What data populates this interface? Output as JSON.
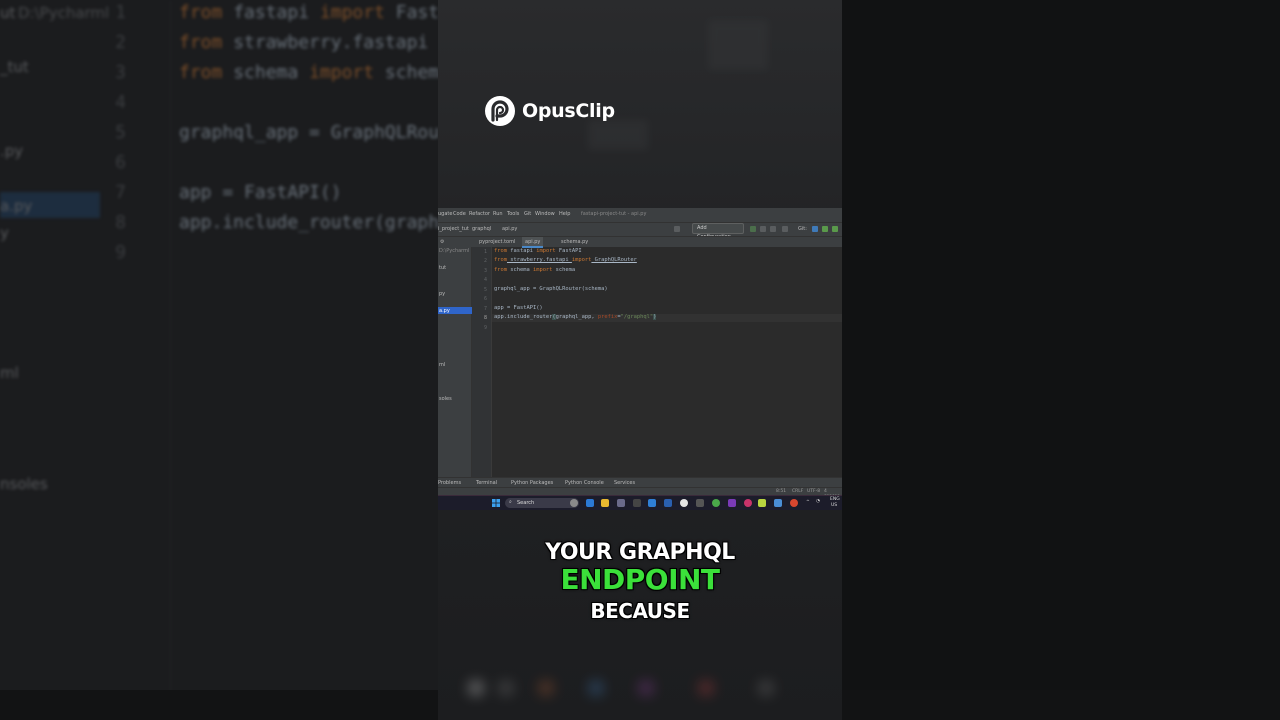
{
  "background": {
    "path_text": "D:\\Pycharml",
    "tree_items": [
      "ut",
      "_tut",
      ".py",
      "a.py",
      "y",
      "ml",
      "nsoles"
    ],
    "line_numbers": [
      "1",
      "2",
      "3",
      "4",
      "5",
      "6",
      "7",
      "8",
      "9"
    ],
    "code_lines": [
      [
        "from",
        " fastapi ",
        "import",
        " Fasta"
      ],
      [
        "from",
        " strawberry.fastapi ",
        "",
        ""
      ],
      [
        "from",
        " schema ",
        "import",
        " schema"
      ],
      [
        "",
        "",
        "",
        ""
      ],
      [
        "",
        "graphql_app = GraphQLRout",
        "",
        ""
      ],
      [
        "",
        "",
        "",
        ""
      ],
      [
        "",
        "app = FastAPI()",
        "",
        ""
      ],
      [
        "",
        "app.include_router(graph",
        "",
        ""
      ],
      [
        "",
        "",
        "",
        ""
      ]
    ]
  },
  "logo": {
    "text": "OpusClip"
  },
  "ide": {
    "menu": [
      "ugate",
      "Code",
      "Refactor",
      "Run",
      "Tools",
      "Git",
      "Window",
      "Help"
    ],
    "window_title": "fastapi-project-tut - api.py",
    "breadcrumb": [
      "i_project_tut",
      "graphql",
      "api.py"
    ],
    "add_configuration": "Add Configuration...",
    "git_label": "Git:",
    "tabs": [
      "pyproject.toml",
      "api.py",
      "schema.py"
    ],
    "active_tab": "api.py",
    "sidebar_items": [
      "D:\\Pycharml",
      "tut",
      "py",
      "a.py",
      "ml",
      "soles"
    ],
    "line_numbers": [
      "1",
      "2",
      "3",
      "4",
      "5",
      "6",
      "7",
      "8",
      "9"
    ],
    "code": {
      "l1": {
        "kw1": "from",
        "mod": " fastapi ",
        "kw2": "import",
        "name": " FastAPI"
      },
      "l2": {
        "kw1": "from",
        "mod": " strawberry.fastapi ",
        "kw2": "import",
        "name": " GraphQLRouter"
      },
      "l3": {
        "kw1": "from",
        "mod": " schema ",
        "kw2": "import",
        "name": " schema"
      },
      "l5": "graphql_app = GraphQLRouter(schema)",
      "l7": "app = FastAPI()",
      "l8_pre": "app.include_router",
      "l8_paren": "(",
      "l8_arg": "graphql_app, ",
      "l8_param": "prefix",
      "l8_eq": "=",
      "l8_str": "\"/graphql\"",
      "l8_close": ")"
    },
    "bottom_tabs": [
      "Problems",
      "Terminal",
      "Python Packages",
      "Python Console",
      "Services"
    ],
    "status": {
      "position": "8:51",
      "line_sep": "CRLF",
      "encoding": "UTF-8",
      "indent": "4 spaces"
    },
    "taskbar": {
      "search_label": "Search",
      "tray_lang": "ENG",
      "tray_region": "US"
    }
  },
  "caption": {
    "line1": "YOUR GRAPHQL",
    "line2": "ENDPOINT",
    "line3": "BECAUSE"
  },
  "colors": {
    "highlight_word": "#3be03a",
    "caption_text": "#ffffff",
    "editor_bg": "#2b2b2b",
    "keyword": "#cc7832",
    "string": "#6a8759"
  }
}
